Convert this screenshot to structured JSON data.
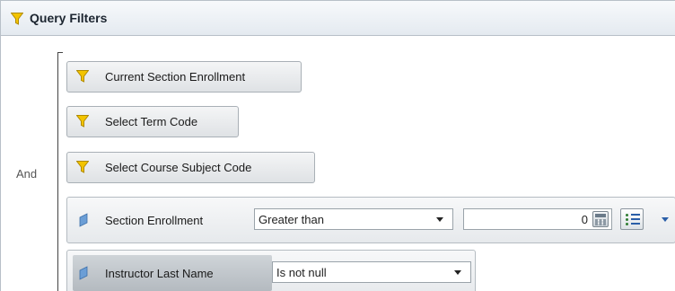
{
  "panel": {
    "title": "Query Filters",
    "operator": "And",
    "accent_yellow": "#f3c400"
  },
  "filters": [
    {
      "label": "Current Section Enrollment",
      "icon": "funnel-icon"
    },
    {
      "label": "Select Term Code",
      "icon": "funnel-icon"
    },
    {
      "label": "Select Course Subject Code",
      "icon": "funnel-icon"
    }
  ],
  "conditions": [
    {
      "label": "Section Enrollment",
      "operator": "Greater than",
      "value": "0",
      "icon": "object-icon"
    },
    {
      "label": "Instructor Last Name",
      "operator": "Is not null",
      "icon": "object-icon"
    }
  ]
}
